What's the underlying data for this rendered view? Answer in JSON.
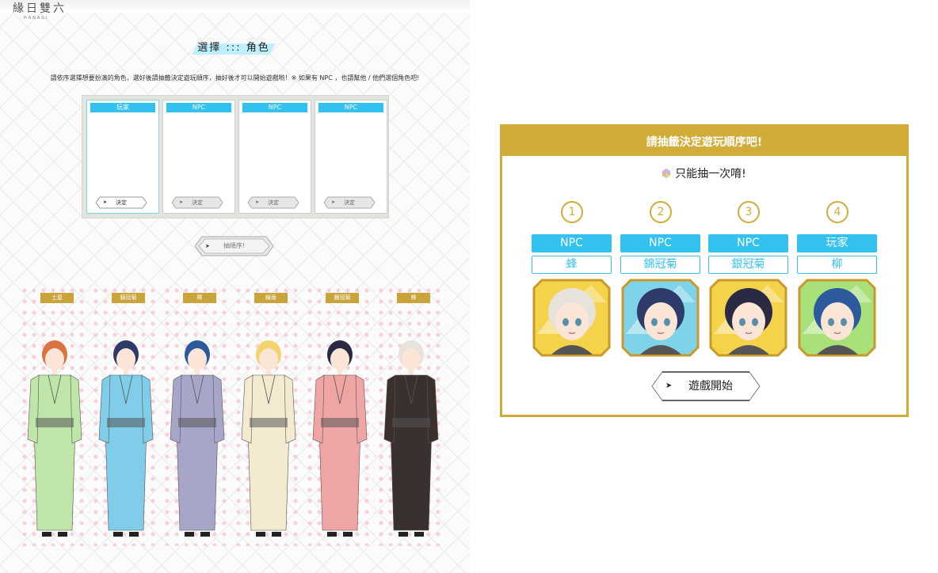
{
  "logo": {
    "text": "緣日雙六",
    "sub": "HANAGI"
  },
  "page_title": "選擇 ::: 角色",
  "instructions": "請依序選擇想要扮演的角色，選好後請抽籤決定遊玩順序，抽好後才可以開始遊戲喲！※ 如果有 NPC ，也請幫他 / 他們選個角色吧!",
  "slots": [
    {
      "tag": "玩家",
      "decide": "決定",
      "selected": true
    },
    {
      "tag": "NPC",
      "decide": "決定",
      "selected": false
    },
    {
      "tag": "NPC",
      "decide": "決定",
      "selected": false
    },
    {
      "tag": "NPC",
      "decide": "決定",
      "selected": false
    }
  ],
  "draw_order_button": "抽順序!",
  "characters": [
    {
      "name": "土星",
      "kimono": "#bfe6a8",
      "hair": "#d9733f"
    },
    {
      "name": "錦冠菊",
      "kimono": "#7fcde8",
      "hair": "#2e3a6a"
    },
    {
      "name": "柳",
      "kimono": "#a8a6c8",
      "hair": "#2c5a9c"
    },
    {
      "name": "線香",
      "kimono": "#f3ead0",
      "hair": "#f3d36b"
    },
    {
      "name": "銀冠菊",
      "kimono": "#f0a5a5",
      "hair": "#2a2a44"
    },
    {
      "name": "蜂",
      "kimono": "#3a302e",
      "hair": "#e8e2dc"
    }
  ],
  "modal": {
    "header": "請抽籤決定遊玩順序吧!",
    "note": "只能抽一次唷!",
    "start_button": "遊戲開始",
    "cards": [
      {
        "number": "1",
        "role": "NPC",
        "name": "蜂",
        "hair": "#e8e2dc",
        "bg": "#f4d24a"
      },
      {
        "number": "2",
        "role": "NPC",
        "name": "錦冠菊",
        "hair": "#2e3a6a",
        "bg": "#7fd3e8"
      },
      {
        "number": "3",
        "role": "NPC",
        "name": "銀冠菊",
        "hair": "#2a2a44",
        "bg": "#f4d24a"
      },
      {
        "number": "4",
        "role": "玩家",
        "name": "柳",
        "hair": "#2c5a9c",
        "bg": "#a8e07a"
      }
    ]
  },
  "colors": {
    "accent_blue": "#33c2ef",
    "gold": "#d2ac38",
    "tag_gold": "#c8a43a"
  }
}
